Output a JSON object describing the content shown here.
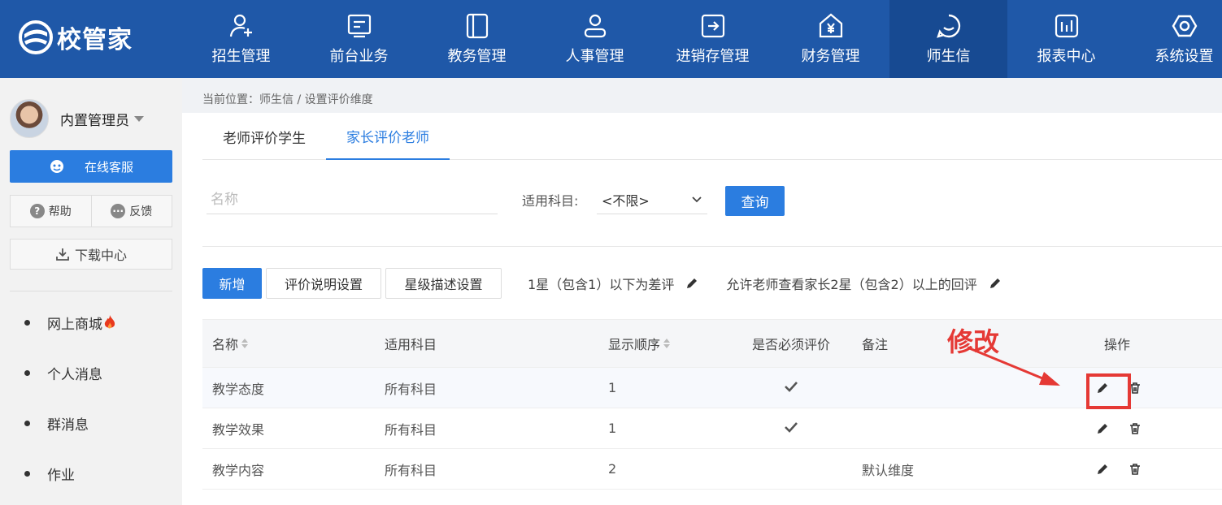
{
  "app": {
    "brand": "校管家"
  },
  "nav": [
    {
      "label": "招生管理",
      "icon": "user-add-icon"
    },
    {
      "label": "前台业务",
      "icon": "desk-icon"
    },
    {
      "label": "教务管理",
      "icon": "book-icon"
    },
    {
      "label": "人事管理",
      "icon": "person-icon"
    },
    {
      "label": "进销存管理",
      "icon": "inventory-icon"
    },
    {
      "label": "财务管理",
      "icon": "finance-icon"
    },
    {
      "label": "师生信",
      "icon": "chat-icon",
      "active": true
    },
    {
      "label": "报表中心",
      "icon": "report-icon"
    },
    {
      "label": "系统设置",
      "icon": "settings-icon"
    }
  ],
  "sidebar": {
    "user_name": "内置管理员",
    "service_label": "在线客服",
    "help_label": "帮助",
    "feedback_label": "反馈",
    "download_label": "下载中心",
    "menu": [
      "网上商城",
      "个人消息",
      "群消息",
      "作业"
    ]
  },
  "breadcrumb": "当前位置：师生信 / 设置评价维度",
  "tabs": [
    "老师评价学生",
    "家长评价老师"
  ],
  "active_tab": 1,
  "filter": {
    "name_placeholder": "名称",
    "subject_label": "适用科目:",
    "subject_value": "<不限>",
    "query_label": "查询"
  },
  "actions": {
    "add_label": "新增",
    "desc_setting_label": "评价说明设置",
    "star_setting_label": "星级描述设置",
    "note_bad": "1星（包含1）以下为差评",
    "note_view": "允许老师查看家长2星（包含2）以上的回评"
  },
  "table": {
    "headers": [
      "名称",
      "适用科目",
      "显示顺序",
      "是否必须评价",
      "备注",
      "操作"
    ],
    "rows": [
      {
        "name": "教学态度",
        "subject": "所有科目",
        "order": "1",
        "required": true,
        "remark": ""
      },
      {
        "name": "教学效果",
        "subject": "所有科目",
        "order": "1",
        "required": true,
        "remark": ""
      },
      {
        "name": "教学内容",
        "subject": "所有科目",
        "order": "2",
        "required": false,
        "remark": "默认维度"
      }
    ]
  },
  "annotation": {
    "text": "修改",
    "color": "#e53935"
  },
  "colors": {
    "topbar": "#1f58a8",
    "primary": "#2b7de0"
  }
}
